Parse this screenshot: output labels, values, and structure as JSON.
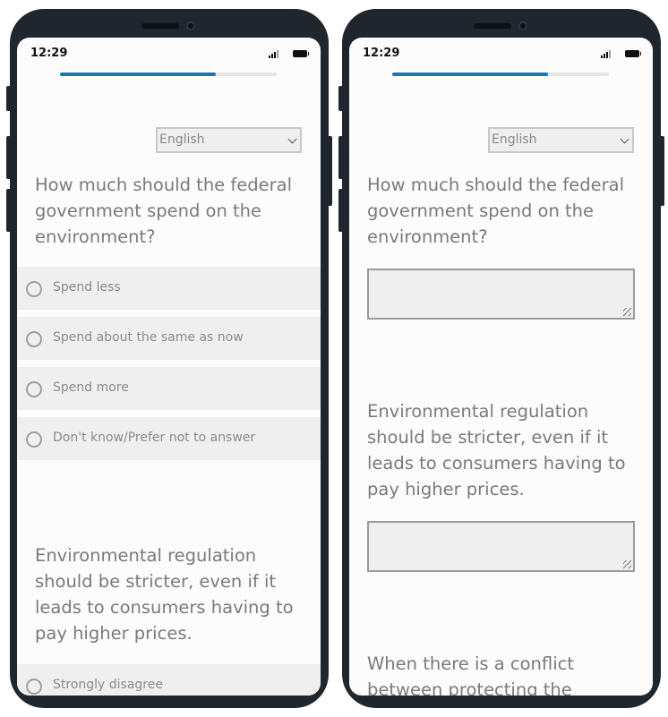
{
  "status_bar": {
    "time": "12:29"
  },
  "survey": {
    "language": "English",
    "progress_fraction": 0.72,
    "q1": {
      "text": "How much should the federal government spend on the environment?",
      "options": [
        "Spend less",
        "Spend about the same as now",
        "Spend more",
        "Don't know/Prefer not to answer"
      ]
    },
    "q2": {
      "text": "Environmental regulation should be stricter, even if it leads to consumers having to pay higher prices.",
      "options": [
        "Strongly disagree"
      ]
    },
    "q3": {
      "text": "When there is a conflict between protecting the"
    }
  },
  "colors": {
    "frame": "#1f262e",
    "accent": "#1279b5",
    "screen_bg": "#fcfcfc",
    "option_bg": "#efefef",
    "text": "#7a7a7a"
  },
  "icons": [
    "signal-icon",
    "battery-icon",
    "chevron-down-icon",
    "radio-icon",
    "resize-grip-icon"
  ]
}
